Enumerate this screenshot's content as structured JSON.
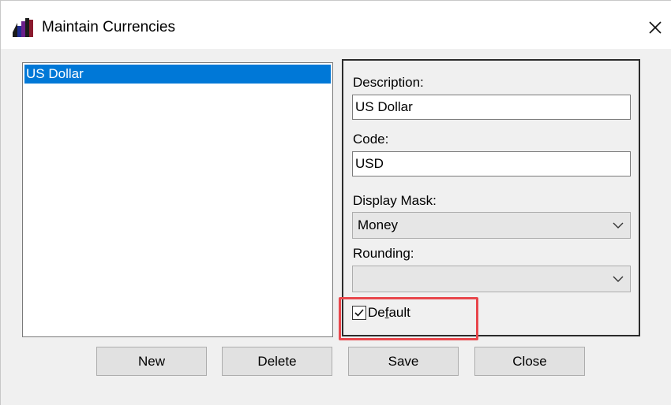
{
  "window": {
    "title": "Maintain Currencies",
    "icon": "app-bars-icon",
    "close_glyph": "✕"
  },
  "currency_list": {
    "items": [
      {
        "label": "US Dollar",
        "selected": true
      }
    ]
  },
  "details": {
    "description_label": "Description:",
    "description_value": "US Dollar",
    "code_label": "Code:",
    "code_value": "USD",
    "display_mask_label": "Display Mask:",
    "display_mask_value": "Money",
    "rounding_label": "Rounding:",
    "rounding_value": "",
    "default_label_pre": "De",
    "default_label_underlined": "f",
    "default_label_post": "ault",
    "default_checked": true
  },
  "buttons": {
    "new": "New",
    "delete": "Delete",
    "save": "Save",
    "close": "Close"
  },
  "colors": {
    "selection": "#0078d7",
    "highlight": "#e8474c",
    "dialog_bg": "#f0f0f0"
  }
}
